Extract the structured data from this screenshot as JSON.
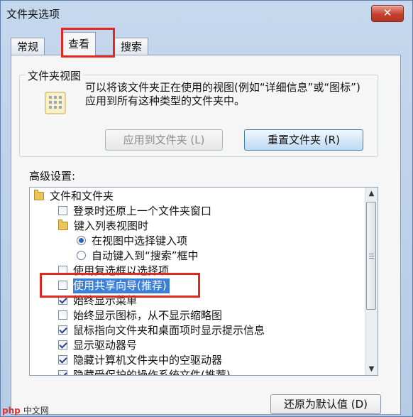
{
  "window": {
    "title": "文件夹选项",
    "close": "✕"
  },
  "tabs": [
    {
      "label": "常规"
    },
    {
      "label": "查看"
    },
    {
      "label": "搜索"
    }
  ],
  "folder_view": {
    "group_label": "文件夹视图",
    "description": "可以将该文件夹正在使用的视图(例如“详细信息”或“图标”)应用到所有这种类型的文件夹中。",
    "apply_button": "应用到文件夹 (L)",
    "reset_button": "重置文件夹 (R)"
  },
  "advanced": {
    "label": "高级设置:",
    "items": [
      {
        "type": "folder",
        "label": "文件和文件夹"
      },
      {
        "type": "checkbox",
        "checked": false,
        "label": "登录时还原上一个文件夹窗口"
      },
      {
        "type": "folder",
        "label": "键入列表视图时"
      },
      {
        "type": "radio",
        "selected": true,
        "label": "在视图中选择键入项"
      },
      {
        "type": "radio",
        "selected": false,
        "label": "自动键入到“搜索”框中"
      },
      {
        "type": "checkbox",
        "checked": false,
        "label": "使用复选框以选择项"
      },
      {
        "type": "checkbox",
        "checked": false,
        "label": "使用共享向导(推荐)"
      },
      {
        "type": "checkbox",
        "checked": true,
        "label": "始终显示菜单"
      },
      {
        "type": "checkbox",
        "checked": false,
        "label": "始终显示图标，从不显示缩略图"
      },
      {
        "type": "checkbox",
        "checked": true,
        "label": "鼠标指向文件夹和桌面项时显示提示信息"
      },
      {
        "type": "checkbox",
        "checked": true,
        "label": "显示驱动器号"
      },
      {
        "type": "checkbox",
        "checked": true,
        "label": "隐藏计算机文件夹中的空驱动器"
      },
      {
        "type": "checkbox",
        "checked": true,
        "label": "隐藏受保护的操作系统文件(推荐)"
      }
    ]
  },
  "restore_defaults_button": "还原为默认值 (D)",
  "watermark": {
    "brand": "php",
    "site": "中文网"
  },
  "colors": {
    "highlight": "#3b7fd6",
    "annotation_red": "#e02a1f"
  }
}
